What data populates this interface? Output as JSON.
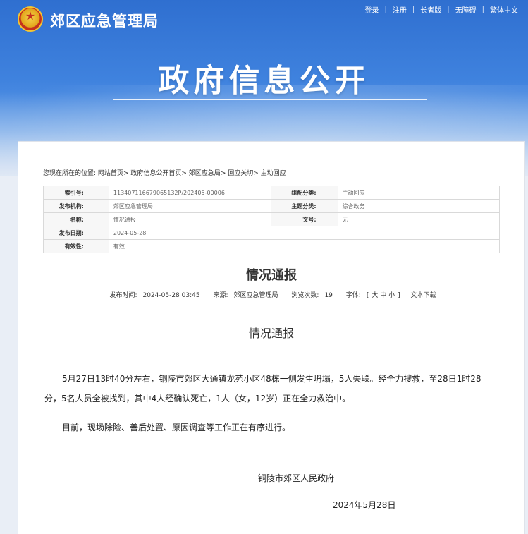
{
  "header": {
    "site_name": "郊区应急管理局",
    "links": [
      "登录",
      "注册",
      "长者版",
      "无障碍",
      "繁体中文"
    ],
    "banner_title": "政府信息公开"
  },
  "breadcrumb": {
    "prefix": "您现在所在的位置:",
    "items": [
      "网站首页",
      "政府信息公开首页",
      "郊区应急局",
      "回应关切",
      "主动回应"
    ],
    "separator": ">"
  },
  "meta": {
    "index_label": "索引号:",
    "index_value": "113407116679065132P/202405-00006",
    "category_label": "组配分类:",
    "category_value": "主动回应",
    "publisher_label": "发布机构:",
    "publisher_value": "郊区应急管理局",
    "topic_label": "主题分类:",
    "topic_value": "综合政务",
    "name_label": "名称:",
    "name_value": "情况通报",
    "docno_label": "文号:",
    "docno_value": "无",
    "date_label": "发布日期:",
    "date_value": "2024-05-28",
    "valid_label": "有效性:",
    "valid_value": "有效"
  },
  "article": {
    "title": "情况通报",
    "publish_time_label": "发布时间:",
    "publish_time": "2024-05-28 03:45",
    "source_label": "来源:",
    "source": "郊区应急管理局",
    "views_label": "浏览次数:",
    "views": "19",
    "font_label": "字体:",
    "font_open": "[",
    "font_large": "大",
    "font_medium": "中",
    "font_small": "小",
    "font_close": "]",
    "download": "文本下载",
    "content_title": "情况通报",
    "paragraph_1": "5月27日13时40分左右，铜陵市郊区大通镇龙苑小区48栋一侧发生坍塌，5人失联。经全力搜救，至28日1时28分，5名人员全被找到，其中4人经确认死亡，1人（女，12岁）正在全力救治中。",
    "paragraph_2": "目前，现场除险、善后处置、原因调查等工作正在有序进行。",
    "signature": "铜陵市郊区人民政府",
    "sign_date": "2024年5月28日"
  }
}
